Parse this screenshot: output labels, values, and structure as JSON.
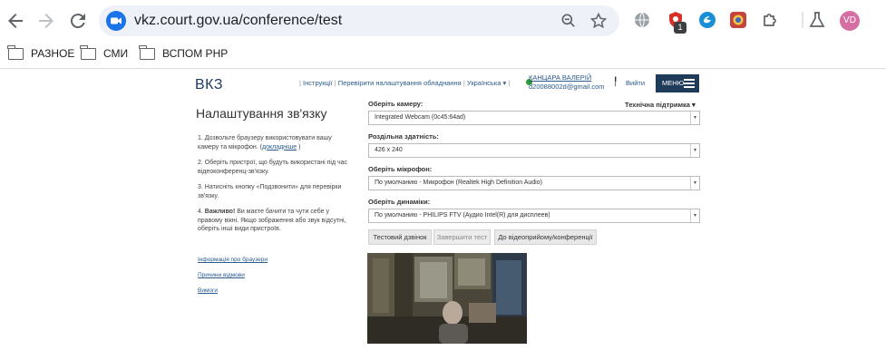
{
  "browser": {
    "url": "vkz.court.gov.ua/conference/test",
    "extension_badge": "1",
    "profile_initials": "VD"
  },
  "bookmarks": [
    {
      "label": "РАЗНОЕ"
    },
    {
      "label": "СМИ"
    },
    {
      "label": "ВСПОМ PHP"
    }
  ],
  "header": {
    "logo": "ВКЗ",
    "nav": [
      "Інструкції",
      "Перевірити налаштування обладнання",
      "Українська"
    ],
    "user_name": "КАНЦАРА ВАЛЕРІЙ",
    "user_email": "d20088002d@gmail.com",
    "logout": "Вийти",
    "menu": "МЕНЮ"
  },
  "main": {
    "title": "Налаштування зв'язку",
    "steps": [
      {
        "num": "1.",
        "text": "Дозвольте браузеру використовувати вашу камеру та мікрофон. (",
        "link": "докладніше",
        "after": ")"
      },
      {
        "num": "2.",
        "text": "Оберіть пристрої, що будуть використані під час відеоконференц-зв'язку."
      },
      {
        "num": "3.",
        "text": "Натисніть кнопку «Подзвонити» для перевірки зв'язку."
      },
      {
        "num": "4.",
        "bold": "Важливо!",
        "text": " Ви маєте бачити та чути себе у правому вікні. Якщо зображення або звук відсутні, оберіть інші види пристроїв."
      }
    ],
    "side_links": [
      "Інформація про браузери",
      "Причини відмови",
      "Вимоги"
    ],
    "support": "Технічна підтримка",
    "fields": {
      "camera_label": "Оберіть камеру:",
      "camera_value": "Integrated Webcam (0c45:64ad)",
      "resolution_label": "Роздільна здатність:",
      "resolution_value": "426 x 240",
      "mic_label": "Оберіть мікрофон:",
      "mic_value": "По умолчанию - Микрофон (Realtek High Definition Audio)",
      "speaker_label": "Оберіть динаміки:",
      "speaker_value": "По умолчанию - PHILIPS FTV (Аудио Intel(R) для дисплеев)"
    },
    "buttons": {
      "test_call": "Тестовий дзвінок",
      "end_test": "Завершити тест",
      "go_conference": "До відеоприйому/конференції"
    }
  }
}
